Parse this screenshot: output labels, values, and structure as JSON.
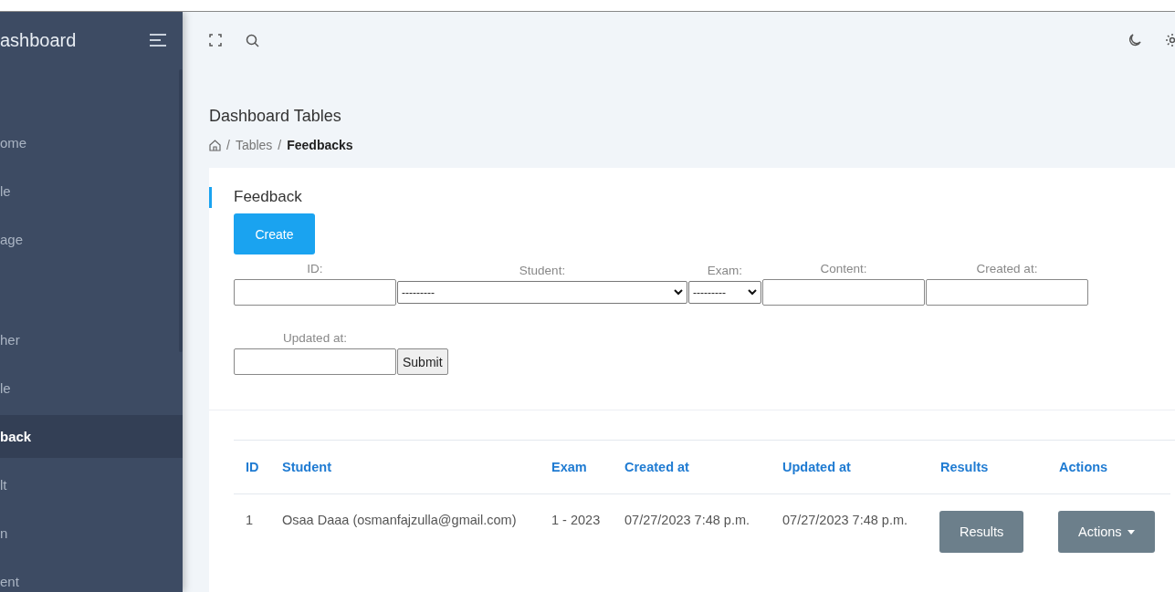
{
  "sidebar": {
    "title": "ashboard",
    "groups": [
      {
        "items": [
          {
            "label": "ome",
            "selected": false
          },
          {
            "label": "le",
            "selected": false
          },
          {
            "label": "age",
            "selected": false
          }
        ]
      },
      {
        "items": [
          {
            "label": "her",
            "selected": false
          },
          {
            "label": "le",
            "selected": false
          },
          {
            "label": "back",
            "selected": true
          },
          {
            "label": "lt",
            "selected": false
          },
          {
            "label": "n",
            "selected": false
          },
          {
            "label": "ent",
            "selected": false
          }
        ]
      }
    ]
  },
  "page": {
    "title": "Dashboard Tables",
    "breadcrumb": [
      {
        "kind": "separator",
        "text": "/"
      },
      {
        "kind": "link",
        "text": "Tables"
      },
      {
        "kind": "separator",
        "text": "/"
      },
      {
        "kind": "current",
        "text": "Feedbacks"
      }
    ]
  },
  "card": {
    "title": "Feedback",
    "create_button": "Create",
    "filters": [
      {
        "label": "ID:",
        "kind": "text"
      },
      {
        "label": "Student:",
        "kind": "wide_select",
        "value": "---------"
      },
      {
        "label": "Exam:",
        "kind": "narrow_select",
        "value": "---------"
      },
      {
        "label": "Content:",
        "kind": "text"
      },
      {
        "label": "Created at:",
        "kind": "text"
      },
      {
        "label": "Updated at:",
        "kind": "text"
      }
    ],
    "submit_button": "Submit"
  },
  "table": {
    "columns": [
      "ID",
      "Student",
      "Exam",
      "Created at",
      "Updated at",
      "Results",
      "Actions"
    ],
    "rows": [
      {
        "cells": [
          "1",
          "Osaa Daaa (osmanfajzulla@gmail.com)",
          "1 - 2023",
          "07/27/2023 7:48 p.m.",
          "07/27/2023 7:48 p.m."
        ],
        "results_button": "Results",
        "actions_button": "Actions"
      }
    ]
  }
}
